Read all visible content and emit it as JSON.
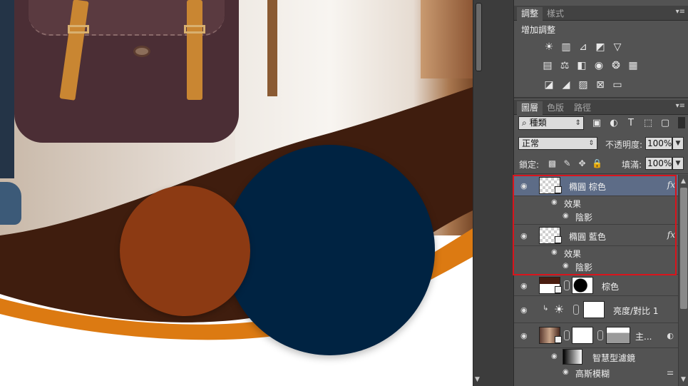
{
  "canvas": {
    "colors": {
      "blue_circle": "#002342",
      "brown_circle": "#8c3a13",
      "wave_dark": "#3f1d0e",
      "wave_orange": "#dc7a12"
    }
  },
  "adjust_panel": {
    "tabs": [
      "調整",
      "樣式"
    ],
    "title": "增加調整",
    "icons_row1": [
      "brightness-icon",
      "levels-icon",
      "curves-icon",
      "exposure-icon",
      "vibrance-icon"
    ],
    "icons_row2": [
      "hue-saturation-icon",
      "color-balance-icon",
      "black-white-icon",
      "photo-filter-icon",
      "channel-mixer-icon",
      "color-lookup-icon"
    ],
    "icons_row3": [
      "invert-icon",
      "posterize-icon",
      "threshold-icon",
      "selective-color-icon",
      "gradient-map-icon"
    ]
  },
  "layers_panel": {
    "tabs": [
      "圖層",
      "色版",
      "路徑"
    ],
    "filter_kind": "種類",
    "blend_mode": "正常",
    "opacity_label": "不透明度:",
    "opacity_value": "100%",
    "lock_label": "鎖定:",
    "fill_label": "填滿:",
    "fill_value": "100%",
    "layers": [
      {
        "name": "橢圓 棕色",
        "fx": "fx",
        "effects_label": "效果",
        "effect": "陰影",
        "selected": true
      },
      {
        "name": "橢圓 藍色",
        "fx": "fx",
        "effects_label": "效果",
        "effect": "陰影",
        "selected": false
      },
      {
        "name": "棕色"
      },
      {
        "name": "亮度/對比 1"
      },
      {
        "name": "主...",
        "smart_filters_label": "智慧型濾鏡",
        "filter": "高斯模糊"
      }
    ]
  }
}
